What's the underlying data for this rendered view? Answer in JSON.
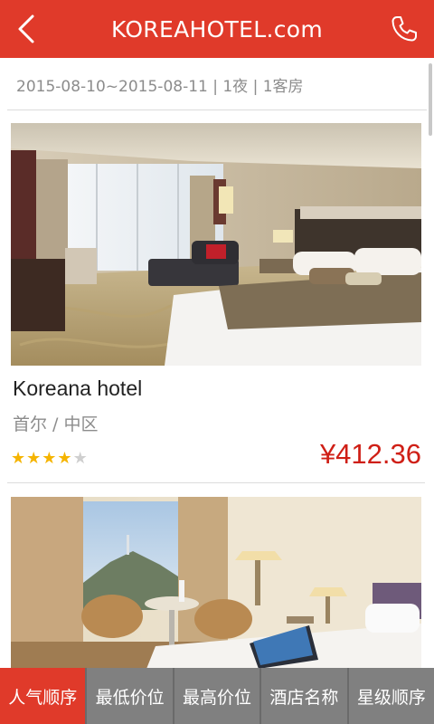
{
  "header": {
    "title": "KOREAHOTEL.com",
    "background": "#e03a2a",
    "back_icon": "chevron-left-icon",
    "phone_icon": "phone-icon"
  },
  "search_summary": "2015-08-10~2015-08-11 | 1夜 | 1客房",
  "hotels": [
    {
      "name": "Koreana hotel",
      "location": "首尔 / 中区",
      "rating": 4,
      "rating_max": 5,
      "price": "¥412.36"
    },
    {
      "name": "",
      "location": "",
      "price": ""
    }
  ],
  "sort_tabs": [
    {
      "label": "人气顺序",
      "active": true
    },
    {
      "label": "最低价位",
      "active": false
    },
    {
      "label": "最高价位",
      "active": false
    },
    {
      "label": "酒店名称",
      "active": false
    },
    {
      "label": "星级顺序",
      "active": false
    }
  ],
  "colors": {
    "accent": "#e03a2a",
    "price": "#cf1f16",
    "star": "#f5b400",
    "tab_inactive": "#808080"
  }
}
